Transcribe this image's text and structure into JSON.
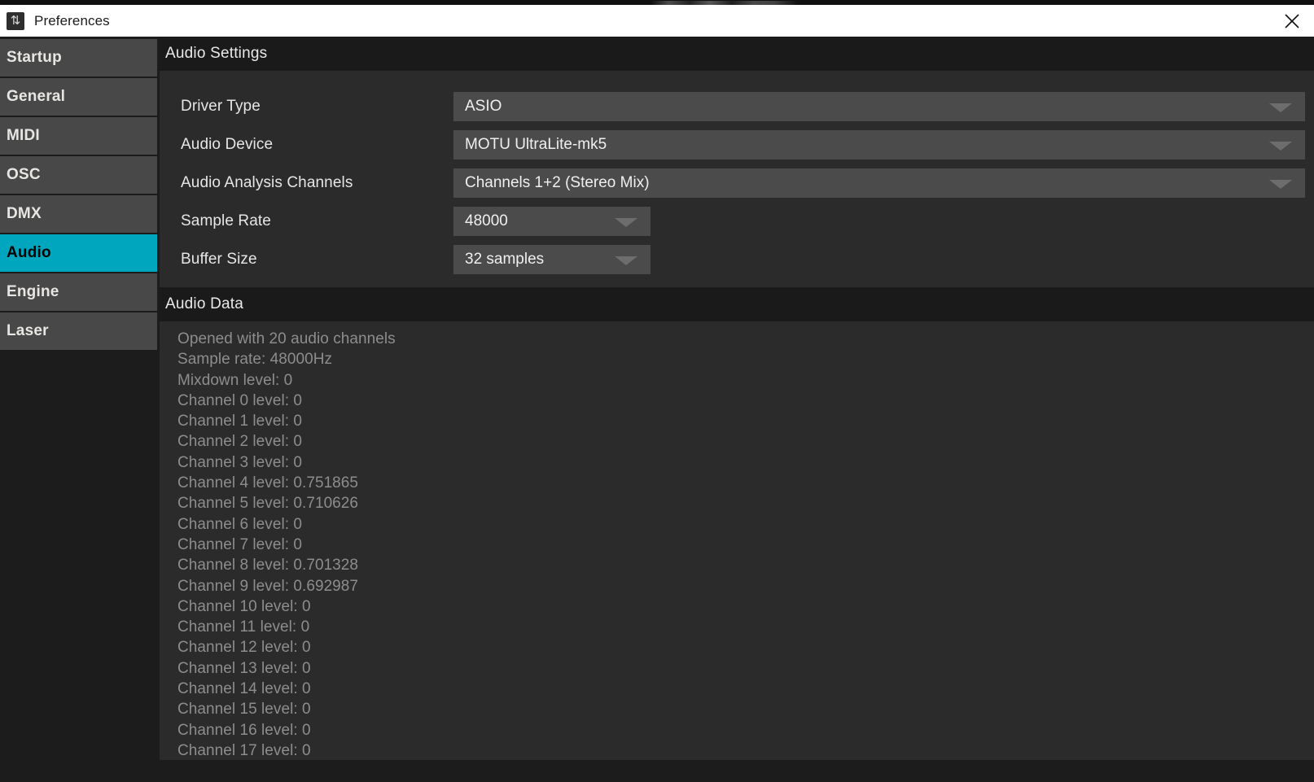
{
  "window": {
    "title": "Preferences",
    "icon": "app-logo-icon",
    "close_label": "✕"
  },
  "sidebar": {
    "items": [
      {
        "label": "Startup",
        "active": false
      },
      {
        "label": "General",
        "active": false
      },
      {
        "label": "MIDI",
        "active": false
      },
      {
        "label": "OSC",
        "active": false
      },
      {
        "label": "DMX",
        "active": false
      },
      {
        "label": "Audio",
        "active": true
      },
      {
        "label": "Engine",
        "active": false
      },
      {
        "label": "Laser",
        "active": false
      }
    ]
  },
  "audio_settings": {
    "header": "Audio Settings",
    "rows": [
      {
        "label": "Driver Type",
        "value": "ASIO",
        "width": "wide"
      },
      {
        "label": "Audio Device",
        "value": "MOTU UltraLite-mk5",
        "width": "wide"
      },
      {
        "label": "Audio Analysis Channels",
        "value": "Channels 1+2 (Stereo Mix)",
        "width": "wide"
      },
      {
        "label": "Sample Rate",
        "value": "48000",
        "width": "narrow"
      },
      {
        "label": "Buffer Size",
        "value": "32 samples",
        "width": "narrow"
      }
    ]
  },
  "audio_data": {
    "header": "Audio Data",
    "lines": [
      "Opened with 20 audio channels",
      "Sample rate: 48000Hz",
      "Mixdown level: 0",
      "Channel 0 level: 0",
      "Channel 1 level: 0",
      "Channel 2 level: 0",
      "Channel 3 level: 0",
      "Channel 4 level: 0.751865",
      "Channel 5 level: 0.710626",
      "Channel 6 level: 0",
      "Channel 7 level: 0",
      "Channel 8 level: 0.701328",
      "Channel 9 level: 0.692987",
      "Channel 10 level: 0",
      "Channel 11 level: 0",
      "Channel 12 level: 0",
      "Channel 13 level: 0",
      "Channel 14 level: 0",
      "Channel 15 level: 0",
      "Channel 16 level: 0",
      "Channel 17 level: 0"
    ]
  },
  "colors": {
    "accent": "#00a6bd",
    "titlebar_bg": "#ffffff",
    "panel_bg": "#2b2b2b",
    "header_bg": "#1a1a1a",
    "sidebar_item_bg": "#484848",
    "field_bg": "#4b4b4b",
    "log_text": "#8d8d8d"
  }
}
